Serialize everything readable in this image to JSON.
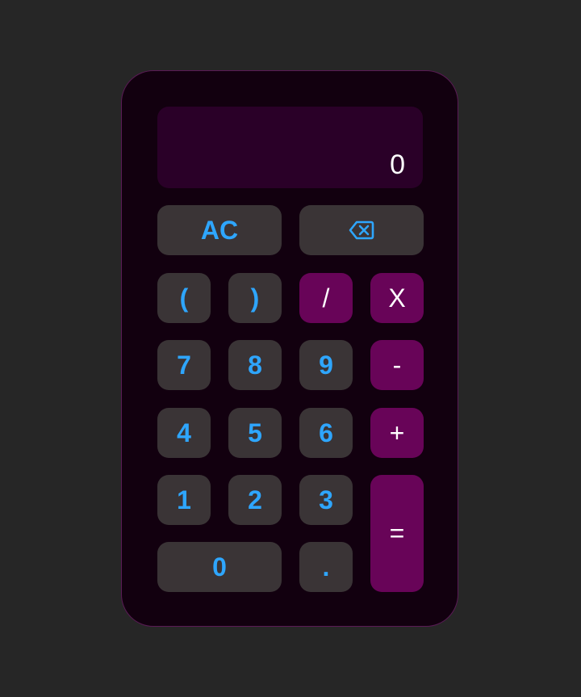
{
  "display": {
    "value": "0"
  },
  "keys": {
    "clear": "AC",
    "backspace_icon": "backspace-icon",
    "open_paren": "(",
    "close_paren": ")",
    "divide": "/",
    "multiply": "X",
    "seven": "7",
    "eight": "8",
    "nine": "9",
    "minus": "-",
    "four": "4",
    "five": "5",
    "six": "6",
    "plus": "+",
    "one": "1",
    "two": "2",
    "three": "3",
    "equals": "=",
    "zero": "0",
    "decimal": "."
  },
  "colors": {
    "background": "#262626",
    "body": "#12000f",
    "display": "#2a0028",
    "key": "#3a3436",
    "operator": "#680458",
    "digit_text": "#2ea6ff",
    "operator_text": "#ffffff"
  }
}
